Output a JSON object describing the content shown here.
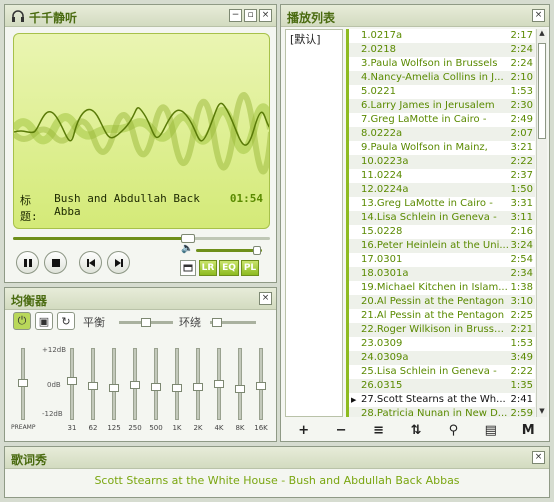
{
  "player": {
    "title": "千千静听",
    "song_label": "标题:",
    "song_title": "Bush and Abdullah Back Abba",
    "time": "01:54",
    "seek_progress": 0.68,
    "volume_level": 0.92,
    "buttons": {
      "lr": "LR",
      "eq": "EQ",
      "pl": "PL"
    }
  },
  "equalizer": {
    "title": "均衡器",
    "balance_label": "平衡",
    "surround_label": "环绕",
    "db_top": "+12dB",
    "db_mid": "0dB",
    "db_bottom": "-12dB",
    "preamp_label": "PREAMP",
    "bands": [
      "31",
      "62",
      "125",
      "250",
      "500",
      "1K",
      "2K",
      "4K",
      "8K",
      "16K"
    ]
  },
  "playlist": {
    "title": "播放列表",
    "category": "[默认]",
    "tracks": [
      {
        "title": "1.0217a",
        "duration": "2:17"
      },
      {
        "title": "2.0218",
        "duration": "2:24"
      },
      {
        "title": "3.Paula Wolfson in Brussels",
        "duration": "2:24"
      },
      {
        "title": "4.Nancy-Amelia Collins in J...",
        "duration": "2:10"
      },
      {
        "title": "5.0221",
        "duration": "1:53"
      },
      {
        "title": "6.Larry James in Jerusalem",
        "duration": "2:30"
      },
      {
        "title": "7.Greg LaMotte in Cairo -",
        "duration": "2:49"
      },
      {
        "title": "8.0222a",
        "duration": "2:07"
      },
      {
        "title": "9.Paula Wolfson in Mainz,",
        "duration": "3:21"
      },
      {
        "title": "10.0223a",
        "duration": "2:22"
      },
      {
        "title": "11.0224",
        "duration": "2:37"
      },
      {
        "title": "12.0224a",
        "duration": "1:50"
      },
      {
        "title": "13.Greg LaMotte in Cairo -",
        "duration": "3:31"
      },
      {
        "title": "14.Lisa Schlein in Geneva -",
        "duration": "3:11"
      },
      {
        "title": "15.0228",
        "duration": "2:16"
      },
      {
        "title": "16.Peter Heinlein at the Uni...",
        "duration": "3:24"
      },
      {
        "title": "17.0301",
        "duration": "2:54"
      },
      {
        "title": "18.0301a",
        "duration": "2:34"
      },
      {
        "title": "19.Michael Kitchen in Islam...",
        "duration": "1:38"
      },
      {
        "title": "20.Al Pessin at the Pentagon",
        "duration": "3:10"
      },
      {
        "title": "21.Al Pessin at the Pentagon",
        "duration": "2:25"
      },
      {
        "title": "22.Roger Wilkison in Brusse...",
        "duration": "2:21"
      },
      {
        "title": "23.0309",
        "duration": "1:53"
      },
      {
        "title": "24.0309a",
        "duration": "3:49"
      },
      {
        "title": "25.Lisa Schlein in Geneva -",
        "duration": "2:22"
      },
      {
        "title": "26.0315",
        "duration": "1:35"
      },
      {
        "title": "27.Scott Stearns at the Wh...",
        "duration": "2:41"
      },
      {
        "title": "28.Patricia Nunan in New D...",
        "duration": "2:59"
      }
    ],
    "current_index": 26,
    "toolbar": [
      "+",
      "−",
      "≡",
      "⇅",
      "⚲",
      "▤",
      "M"
    ]
  },
  "lyrics": {
    "title": "歌词秀",
    "text": "Scott Stearns at the White House - Bush and Abdullah Back Abbas"
  },
  "colors": {
    "accent": "#8dbb20",
    "track_text": "#5a8a00",
    "lyric": "#7aa610"
  }
}
